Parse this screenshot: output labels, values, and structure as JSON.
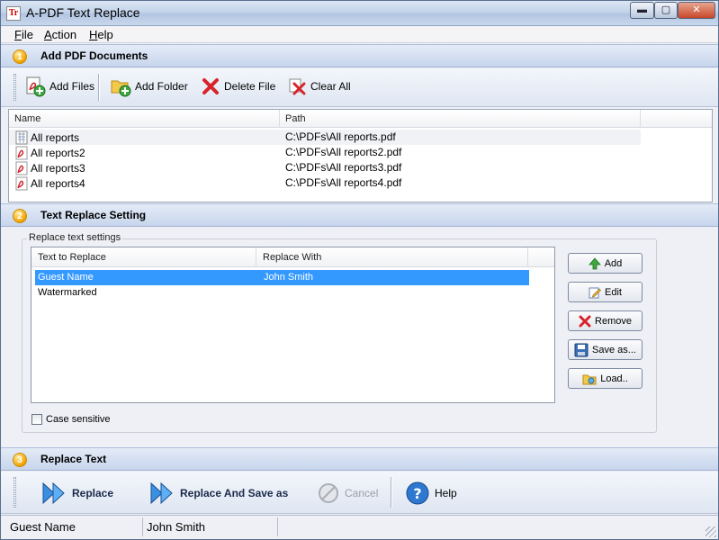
{
  "window": {
    "title": "A-PDF Text Replace",
    "min_glyph": "▬",
    "max_glyph": "▢",
    "close_glyph": "✕",
    "icon_text": "Tr"
  },
  "menu": {
    "items": [
      "File",
      "Action",
      "Help"
    ]
  },
  "sections": [
    {
      "step": "1",
      "title": "Add PDF Documents"
    },
    {
      "step": "2",
      "title": "Text Replace Setting"
    },
    {
      "step": "3",
      "title": "Replace Text"
    }
  ],
  "toolbar1": {
    "add_files": "Add Files",
    "add_folder": "Add Folder",
    "delete_file": "Delete File",
    "clear_all": "Clear All"
  },
  "file_list": {
    "columns": [
      "Name",
      "Path"
    ],
    "rows": [
      {
        "name": "All reports",
        "path": "C:\\PDFs\\All reports.pdf"
      },
      {
        "name": "All reports2",
        "path": "C:\\PDFs\\All reports2.pdf"
      },
      {
        "name": "All reports3",
        "path": "C:\\PDFs\\All reports3.pdf"
      },
      {
        "name": "All reports4",
        "path": "C:\\PDFs\\All reports4.pdf"
      }
    ]
  },
  "replace_settings": {
    "group_label": "Replace text settings",
    "columns": [
      "Text to Replace",
      "Replace With"
    ],
    "rows": [
      {
        "find": "Guest Name",
        "replace": "John Smith",
        "selected": true
      },
      {
        "find": "Watermarked",
        "replace": "",
        "selected": false
      }
    ],
    "case_sensitive_label": "Case sensitive",
    "case_sensitive": false
  },
  "side_buttons": {
    "add": "Add",
    "edit": "Edit",
    "remove": "Remove",
    "save_as": "Save as...",
    "load": "Load.."
  },
  "toolbar3": {
    "replace": "Replace",
    "replace_save_as": "Replace And Save as",
    "cancel": "Cancel",
    "help": "Help"
  },
  "status": {
    "find": "Guest Name",
    "replace": "John Smith"
  },
  "colors": {
    "accent": "#3399ff",
    "step_badge": "#f0a400"
  }
}
